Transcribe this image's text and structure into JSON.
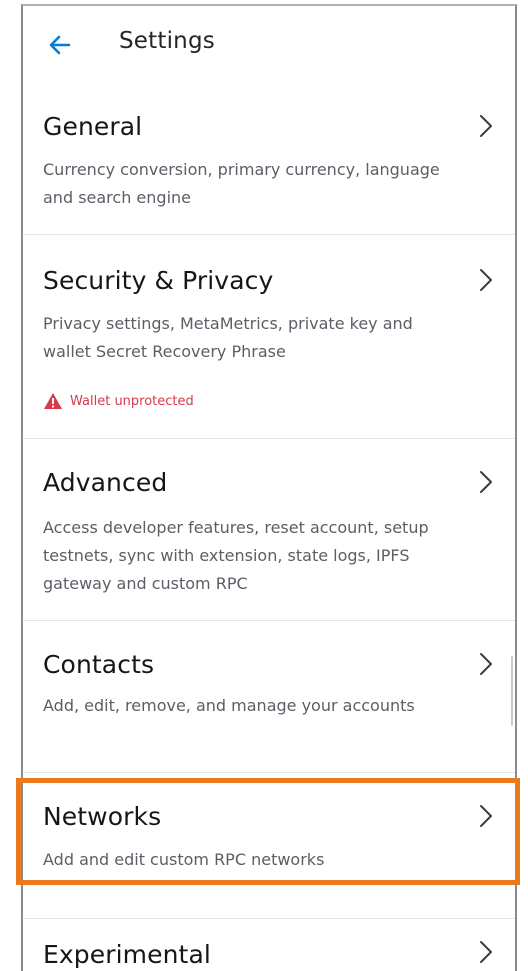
{
  "header": {
    "title": "Settings"
  },
  "items": [
    {
      "title": "General",
      "description": "Currency conversion, primary currency, language and search engine"
    },
    {
      "title": "Security & Privacy",
      "description": "Privacy settings, MetaMetrics, private key and wallet Secret Recovery Phrase",
      "warning": "Wallet unprotected"
    },
    {
      "title": "Advanced",
      "description": "Access developer features, reset account, setup testnets, sync with extension, state logs, IPFS gateway and custom RPC"
    },
    {
      "title": "Contacts",
      "description": "Add, edit, remove, and manage your accounts"
    },
    {
      "title": "Networks",
      "description": "Add and edit custom RPC networks"
    },
    {
      "title": "Experimental",
      "description": ""
    }
  ],
  "colors": {
    "accent": "#037dd6",
    "warning": "#d73a49",
    "highlight": "#ec7a1c"
  },
  "icons": {
    "back": "arrow-left-icon",
    "chevron": "chevron-right-icon",
    "warning": "warning-triangle-icon"
  }
}
